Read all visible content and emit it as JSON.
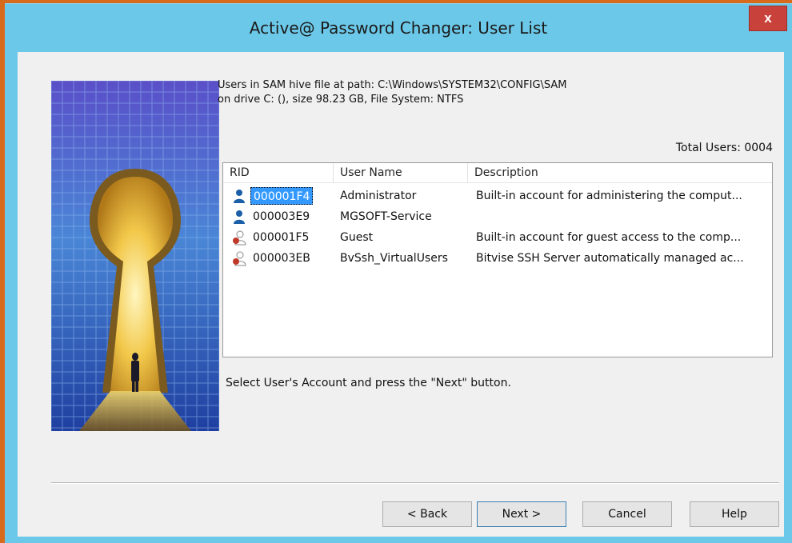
{
  "window": {
    "title": "Active@ Password Changer: User List",
    "close_label": "x"
  },
  "info": {
    "line1": "Users in SAM hive file at path: C:\\Windows\\SYSTEM32\\CONFIG\\SAM",
    "line2": "on drive C: (), size 98.23 GB, File System: NTFS"
  },
  "total_users": "Total Users: 0004",
  "list": {
    "columns": [
      "RID",
      "User Name",
      "Description"
    ],
    "rows": [
      {
        "rid": "000001F4",
        "name": "Administrator",
        "description": "Built-in account for administering the comput...",
        "icon": "user-active-icon",
        "selected": true
      },
      {
        "rid": "000003E9",
        "name": "MGSOFT-Service",
        "description": "",
        "icon": "user-active-icon",
        "selected": false
      },
      {
        "rid": "000001F5",
        "name": "Guest",
        "description": "Built-in account for guest access to the comp...",
        "icon": "user-disabled-icon",
        "selected": false
      },
      {
        "rid": "000003EB",
        "name": "BvSsh_VirtualUsers",
        "description": "Bitvise SSH Server automatically managed ac...",
        "icon": "user-disabled-icon",
        "selected": false
      }
    ]
  },
  "hint": "Select User's Account and press the \"Next\" button.",
  "buttons": {
    "back": "< Back",
    "next": "Next >",
    "cancel": "Cancel",
    "help": "Help"
  },
  "colors": {
    "titlebar": "#6cc8e8",
    "close": "#c8413a",
    "selection": "#3399ff",
    "active_user": "#1a5fa8",
    "disabled_user": "#c0392b"
  }
}
